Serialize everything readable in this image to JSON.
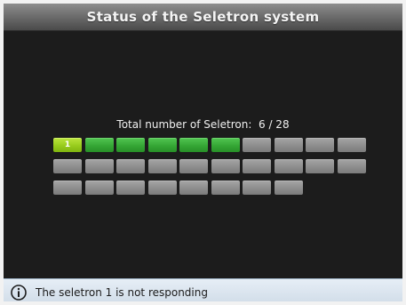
{
  "header": {
    "title": "Status of the Seletron system"
  },
  "summary": {
    "label": "Total number of Seletron:",
    "value": "6 / 28"
  },
  "seletrons": [
    {
      "label": "1",
      "state": "selected"
    },
    {
      "label": "",
      "state": "active"
    },
    {
      "label": "",
      "state": "active"
    },
    {
      "label": "",
      "state": "active"
    },
    {
      "label": "",
      "state": "active"
    },
    {
      "label": "",
      "state": "active"
    },
    {
      "label": "",
      "state": "inactive"
    },
    {
      "label": "",
      "state": "inactive"
    },
    {
      "label": "",
      "state": "inactive"
    },
    {
      "label": "",
      "state": "inactive"
    },
    {
      "label": "",
      "state": "inactive"
    },
    {
      "label": "",
      "state": "inactive"
    },
    {
      "label": "",
      "state": "inactive"
    },
    {
      "label": "",
      "state": "inactive"
    },
    {
      "label": "",
      "state": "inactive"
    },
    {
      "label": "",
      "state": "inactive"
    },
    {
      "label": "",
      "state": "inactive"
    },
    {
      "label": "",
      "state": "inactive"
    },
    {
      "label": "",
      "state": "inactive"
    },
    {
      "label": "",
      "state": "inactive"
    },
    {
      "label": "",
      "state": "inactive"
    },
    {
      "label": "",
      "state": "inactive"
    },
    {
      "label": "",
      "state": "inactive"
    },
    {
      "label": "",
      "state": "inactive"
    },
    {
      "label": "",
      "state": "inactive"
    },
    {
      "label": "",
      "state": "inactive"
    },
    {
      "label": "",
      "state": "inactive"
    },
    {
      "label": "",
      "state": "inactive"
    }
  ],
  "status": {
    "icon": "info-icon",
    "message": "The seletron 1 is not responding"
  },
  "colors": {
    "background": "#1c1c1c",
    "active": "#36a836",
    "selected": "#9acd1e",
    "inactive": "#8e8e8e",
    "status_bar": "#cfdbe7"
  }
}
